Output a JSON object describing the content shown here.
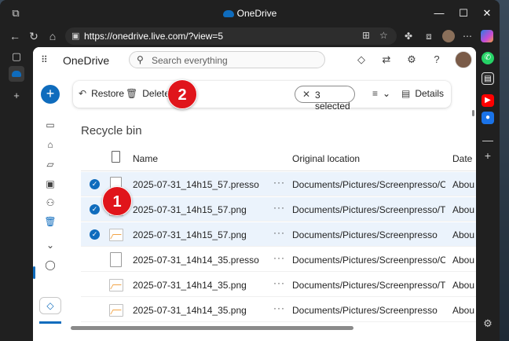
{
  "browser": {
    "title": "OneDrive",
    "url": "https://onedrive.live.com/?view=5"
  },
  "app": {
    "brand": "OneDrive",
    "search_placeholder": "Search everything"
  },
  "command_bar": {
    "restore_label": "Restore",
    "delete_label": "Delete",
    "selected_label": "3 selected",
    "details_label": "Details"
  },
  "badges": {
    "one": "1",
    "two": "2"
  },
  "page": {
    "heading": "Recycle bin"
  },
  "table": {
    "headers": {
      "name": "Name",
      "location": "Original location",
      "date": "Date"
    },
    "rows": [
      {
        "name": "2025-07-31_14h15_57.presso",
        "location": "Documents/Pictures/Screenpresso/Originals",
        "date": "Abou",
        "selected": true,
        "icon": "file-icon"
      },
      {
        "name": "2025-07-31_14h15_57.png",
        "location": "Documents/Pictures/Screenpresso/Thumbn...",
        "date": "Abou",
        "selected": true,
        "icon": "image-file-icon"
      },
      {
        "name": "2025-07-31_14h15_57.png",
        "location": "Documents/Pictures/Screenpresso",
        "date": "Abou",
        "selected": true,
        "icon": "image-file-icon"
      },
      {
        "name": "2025-07-31_14h14_35.presso",
        "location": "Documents/Pictures/Screenpresso/Originals",
        "date": "Abou",
        "selected": false,
        "icon": "file-icon"
      },
      {
        "name": "2025-07-31_14h14_35.png",
        "location": "Documents/Pictures/Screenpresso/Thumbn...",
        "date": "Abou",
        "selected": false,
        "icon": "image-file-icon"
      },
      {
        "name": "2025-07-31_14h14_35.png",
        "location": "Documents/Pictures/Screenpresso",
        "date": "Abou",
        "selected": false,
        "icon": "image-file-icon"
      }
    ]
  },
  "colors": {
    "accent": "#0f6cbd",
    "badge": "#e0151b",
    "selected_row": "#ebf3fc"
  }
}
